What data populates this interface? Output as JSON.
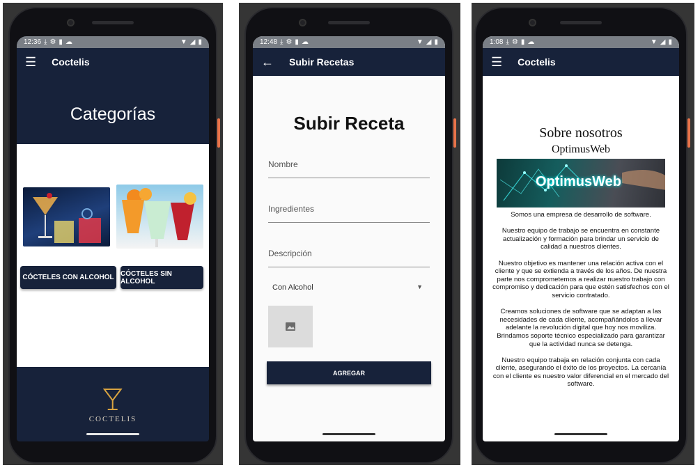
{
  "phone1": {
    "status_time": "12:36",
    "appbar_title": "Coctelis",
    "hero_title": "Categorías",
    "button_alcohol": "CÓCTELES CON ALCOHOL",
    "button_sin_alcohol": "CÓCTELES SIN ALCOHOL",
    "logo_text": "COCTELIS"
  },
  "phone2": {
    "status_time": "12:48",
    "appbar_title": "Subir Recetas",
    "page_title": "Subir Receta",
    "field_nombre": "Nombre",
    "field_ingredientes": "Ingredientes",
    "field_descripcion": "Descripción",
    "dropdown_value": "Con Alcohol",
    "add_button": "AGREGAR"
  },
  "phone3": {
    "status_time": "1:08",
    "appbar_title": "Coctelis",
    "heading": "Sobre nosotros",
    "subheading": "OptimusWeb",
    "banner_text": "OptimusWeb",
    "paragraphs": [
      "Somos una empresa de desarrollo de software.",
      "Nuestro equipo de trabajo se encuentra en constante actualización y formación para brindar un servicio de calidad a nuestros clientes.",
      "Nuestro objetivo es mantener una relación activa con el cliente y que se extienda a través de los años. De nuestra parte nos comprometemos a realizar nuestro trabajo con compromiso y dedicación para que estén satisfechos con el servicio contratado.",
      "Creamos soluciones de software que se adaptan a las necesidades de cada cliente, acompañándolos a llevar adelante la revolución digital que hoy nos moviliza. Brindamos soporte técnico especializado para garantizar que la actividad nunca se detenga.",
      "Nuestro equipo trabaja en relación conjunta con cada cliente, asegurando el éxito de los proyectos. La cercanía con el cliente es nuestro valor diferencial en el mercado del software."
    ]
  },
  "colors": {
    "primary": "#17223a",
    "status_bar": "#7a7f86",
    "accent_button": "#e8734a"
  },
  "icons": [
    "menu-icon",
    "back-arrow-icon",
    "dropdown-arrow-icon",
    "image-placeholder-icon",
    "wifi-icon",
    "signal-icon",
    "battery-icon",
    "download-icon",
    "cocktail-glass-icon"
  ]
}
